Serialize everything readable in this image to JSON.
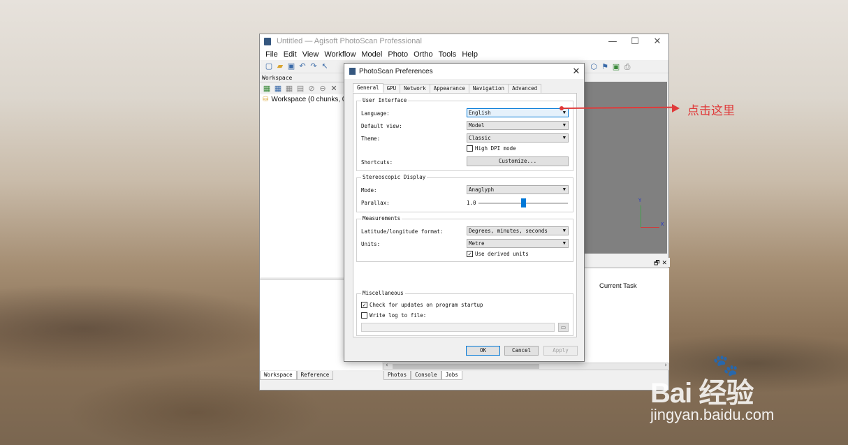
{
  "app": {
    "title": "Untitled — Agisoft PhotoScan Professional",
    "window_controls": {
      "minimize": "—",
      "maximize": "☐",
      "close": "✕"
    },
    "menu": [
      "File",
      "Edit",
      "View",
      "Workflow",
      "Model",
      "Photo",
      "Ortho",
      "Tools",
      "Help"
    ],
    "workspace_header": "Workspace",
    "workspace_item": "Workspace (0 chunks, 0 ca",
    "left_tabs": [
      "Workspace",
      "Reference"
    ],
    "bottom_tabs": [
      "Photos",
      "Console",
      "Jobs"
    ],
    "current_task_label": "Current Task",
    "axis_labels": {
      "y": "Y",
      "x": "X"
    },
    "panel_controls": "🗗 ✕"
  },
  "dialog": {
    "title": "PhotoScan Preferences",
    "close": "✕",
    "tabs": [
      "General",
      "GPU",
      "Network",
      "Appearance",
      "Navigation",
      "Advanced"
    ],
    "user_interface": {
      "title": "User Interface",
      "language_label": "Language:",
      "language_value": "English",
      "default_view_label": "Default view:",
      "default_view_value": "Model",
      "theme_label": "Theme:",
      "theme_value": "Classic",
      "high_dpi_label": "High DPI mode",
      "high_dpi_checked": false,
      "shortcuts_label": "Shortcuts:",
      "customize_button": "Customize..."
    },
    "stereoscopic": {
      "title": "Stereoscopic Display",
      "mode_label": "Mode:",
      "mode_value": "Anaglyph",
      "parallax_label": "Parallax:",
      "parallax_value": "1.0",
      "parallax_slider_fraction": 0.5
    },
    "measurements": {
      "title": "Measurements",
      "latlon_label": "Latitude/longitude format:",
      "latlon_value": "Degrees, minutes, seconds",
      "units_label": "Units:",
      "units_value": "Metre",
      "derived_units_label": "Use derived units",
      "derived_units_checked": true
    },
    "misc": {
      "title": "Miscellaneous",
      "check_updates_label": "Check for updates on program startup",
      "check_updates_checked": true,
      "write_log_label": "Write log to file:",
      "write_log_checked": false,
      "log_path": ""
    },
    "buttons": {
      "ok": "OK",
      "cancel": "Cancel",
      "apply": "Apply"
    }
  },
  "annotation": {
    "text": "点击这里",
    "color": "#e03a3a"
  },
  "watermark": {
    "logo": "Bai  经验",
    "url": "jingyan.baidu.com"
  },
  "colors": {
    "accent": "#0078d7",
    "viewport": "#808080",
    "annotation": "#e03a3a"
  }
}
